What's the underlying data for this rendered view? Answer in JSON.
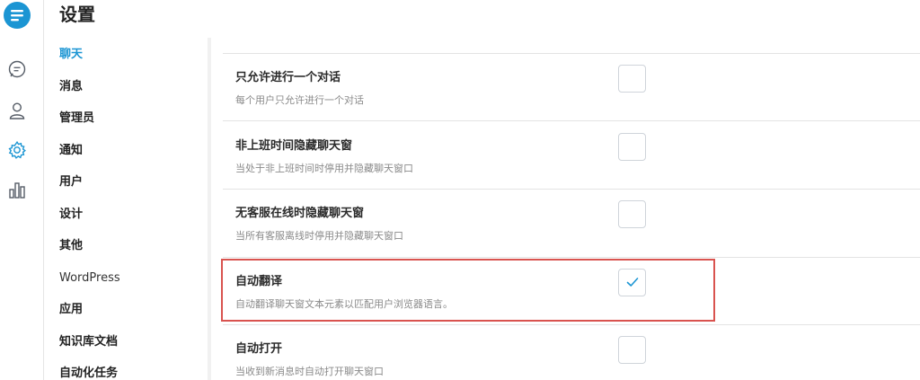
{
  "app": {
    "title": "设置"
  },
  "rail": {
    "logo_icon": "chat-bubble-logo-icon",
    "items": [
      {
        "icon": "conversations-icon"
      },
      {
        "icon": "user-icon"
      },
      {
        "icon": "gear-icon",
        "active": true
      },
      {
        "icon": "bar-chart-icon"
      }
    ]
  },
  "nav": {
    "items": [
      {
        "label": "聊天",
        "active": true
      },
      {
        "label": "消息"
      },
      {
        "label": "管理员"
      },
      {
        "label": "通知"
      },
      {
        "label": "用户"
      },
      {
        "label": "设计"
      },
      {
        "label": "其他"
      },
      {
        "label": "WordPress"
      },
      {
        "label": "应用"
      },
      {
        "label": "知识库文档"
      },
      {
        "label": "自动化任务"
      }
    ]
  },
  "settings": {
    "rows": [
      {
        "title": "只允许进行一个对话",
        "desc": "每个用户只允许进行一个对话",
        "checked": false
      },
      {
        "title": "非上班时间隐藏聊天窗",
        "desc": "当处于非上班时间时停用并隐藏聊天窗口",
        "checked": false
      },
      {
        "title": "无客服在线时隐藏聊天窗",
        "desc": "当所有客服离线时停用并隐藏聊天窗口",
        "checked": false
      },
      {
        "title": "自动翻译",
        "desc": "自动翻译聊天窗文本元素以匹配用户浏览器语言。",
        "checked": true
      },
      {
        "title": "自动打开",
        "desc": "当收到新消息时自动打开聊天窗口",
        "checked": false
      }
    ]
  },
  "colors": {
    "accent": "#1b95d3",
    "highlight_border": "#d9534f",
    "check_color": "#1b95d3"
  }
}
